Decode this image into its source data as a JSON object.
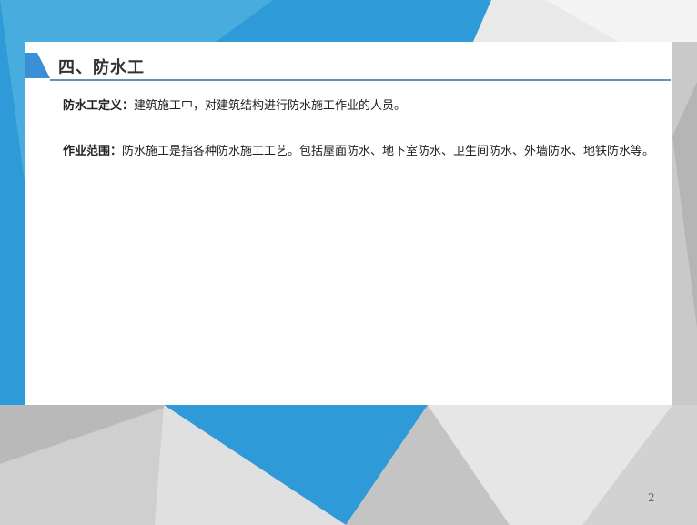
{
  "slide": {
    "title": "四、防水工",
    "paragraphs": [
      {
        "label": "防水工定义：",
        "text": "建筑施工中，对建筑结构进行防水施工作业的人员。"
      },
      {
        "label": "作业范围：",
        "text": "防水施工是指各种防水施工工艺。包括屋面防水、地下室防水、卫生间防水、外墙防水、地铁防水等。"
      }
    ],
    "page_number": "2"
  },
  "colors": {
    "accent_blue": "#3b8fd4",
    "title_rule": "#6d8fb0"
  }
}
